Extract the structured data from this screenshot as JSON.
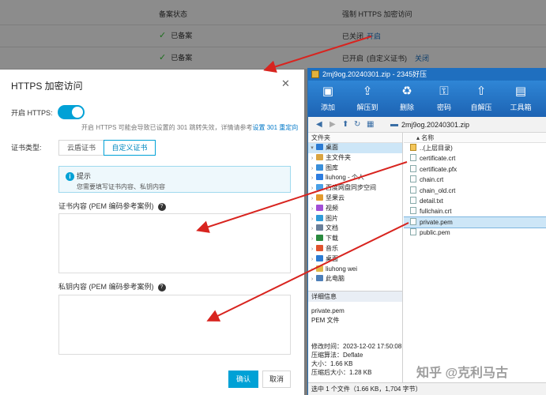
{
  "background": {
    "headers": {
      "filing": "备案状态",
      "https": "强制 HTTPS 加密访问"
    },
    "rows": [
      {
        "filing": "已备案",
        "status": "已关闭",
        "action": "开启"
      },
      {
        "filing": "已备案",
        "status": "已开启",
        "extra": "(自定义证书)",
        "action": "关闭"
      }
    ]
  },
  "dialog": {
    "title": "HTTPS 加密访问",
    "enable_label": "开启 HTTPS:",
    "hint": "开启 HTTPS 可能会导致已设置的 301 跳转失效，详情请参考",
    "hint_link": "设置 301 重定向",
    "cert_type_label": "证书类型:",
    "cert_types": [
      "云盾证书",
      "自定义证书"
    ],
    "tip_title": "提示",
    "tip_text": "您需要填写证书内容、私钥内容",
    "cert_content_label": "证书内容 (PEM 编码参考案例)",
    "key_content_label": "私钥内容 (PEM 编码参考案例)",
    "confirm": "确认",
    "cancel": "取消"
  },
  "zip": {
    "title": "2mj9og.20240301.zip - 2345好压",
    "tools": [
      "添加",
      "解压到",
      "删除",
      "密码",
      "自解压",
      "工具箱"
    ],
    "path": "2mj9og.20240301.zip",
    "folder_header": "文件夹",
    "name_header": "名称",
    "tree": [
      {
        "label": "桌面",
        "selected": true,
        "color": "#2b7bd3"
      },
      {
        "label": "主文件夹",
        "color": "#d9a441"
      },
      {
        "label": "图库",
        "color": "#3b8fd9"
      },
      {
        "label": "liuhong - 个人",
        "color": "#2e7de0"
      },
      {
        "label": "百度网盘同步空间",
        "color": "#4aa0e6"
      },
      {
        "label": "坚果云",
        "color": "#e39a2d"
      },
      {
        "label": "视频",
        "color": "#a24fd6"
      },
      {
        "label": "图片",
        "color": "#2f9bd8"
      },
      {
        "label": "文档",
        "color": "#6a7f99"
      },
      {
        "label": "下载",
        "color": "#2a8a3e"
      },
      {
        "label": "音乐",
        "color": "#e0532e"
      },
      {
        "label": "桌面",
        "color": "#2b7bd3"
      },
      {
        "label": "liuhong wei",
        "color": "#e0b84a"
      },
      {
        "label": "此电脑",
        "color": "#4d7fb8"
      }
    ],
    "files": [
      {
        "name": "..(上层目录)",
        "folder": true
      },
      {
        "name": "certificate.crt"
      },
      {
        "name": "certificate.pfx"
      },
      {
        "name": "chain.crt"
      },
      {
        "name": "chain_old.crt"
      },
      {
        "name": "detail.txt"
      },
      {
        "name": "fullchain.crt"
      },
      {
        "name": "private.pem",
        "selected": true
      },
      {
        "name": "public.pem"
      }
    ],
    "details": {
      "header": "详细信息",
      "name": "private.pem",
      "type": "PEM 文件",
      "modified": "修改时间：2023-12-02 17:50:08",
      "method": "压缩算法：Deflate",
      "size": "大小：1.66 KB",
      "packed": "压缩后大小：1.28 KB"
    },
    "status": "选中 1 个文件（1.66 KB，1,704 字节）",
    "watermark": "知乎 @克利马古"
  },
  "colors": {
    "accent": "#00a1d6",
    "arrow": "#d8241f",
    "zip_blue": "#1f6fbf"
  }
}
